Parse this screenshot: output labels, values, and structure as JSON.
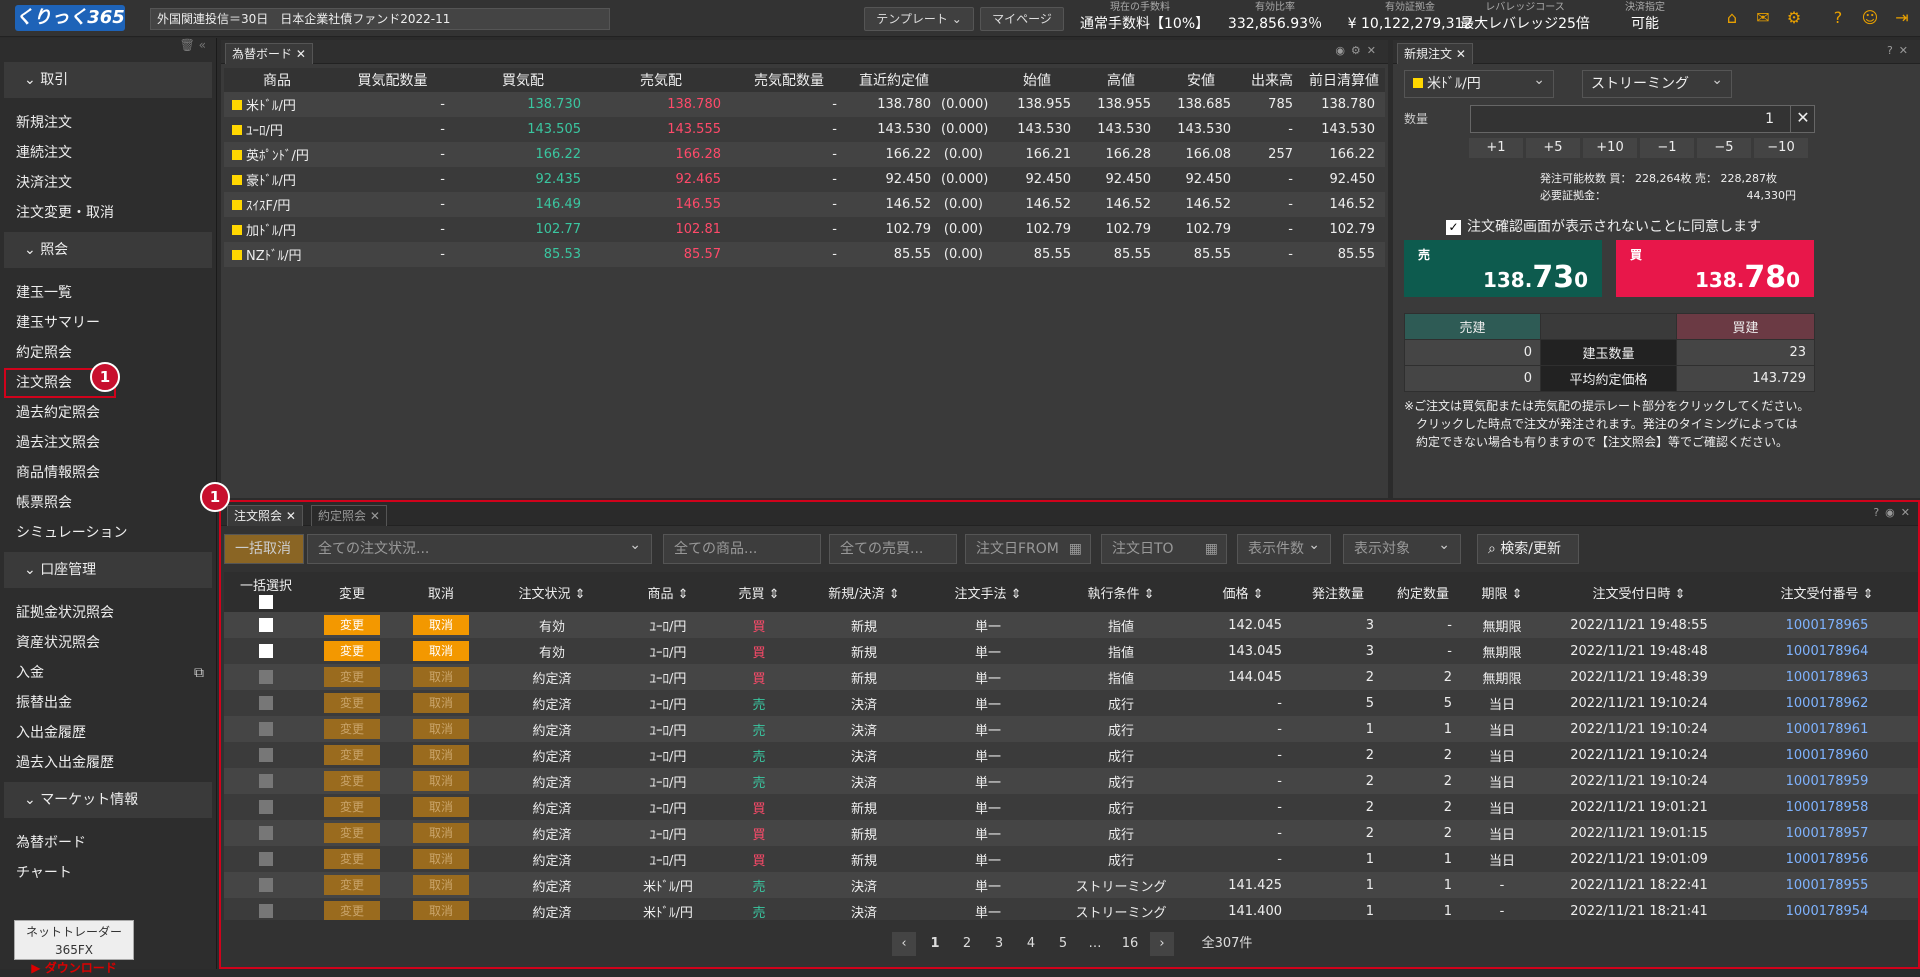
{
  "header": {
    "logo": "くりっく365",
    "ticker": "外国関連投信＝30日　日本企業社債ファンド2022-11",
    "template_btn": "テンプレート ⌄",
    "mypage_btn": "マイページ",
    "metrics": [
      {
        "k": "現在の手数料",
        "v": "通常手数料【10%】"
      },
      {
        "k": "有効比率",
        "v": "332,856.93％"
      },
      {
        "k": "有効証拠金",
        "v": "¥ 10,122,279,312"
      },
      {
        "k": "レバレッジコース",
        "v": "最大レバレッジ25倍"
      },
      {
        "k": "決済指定",
        "v": "可能"
      }
    ]
  },
  "sidebar": {
    "sections": [
      {
        "title": "取引",
        "items": [
          "新規注文",
          "連続注文",
          "決済注文",
          "注文変更・取消"
        ]
      },
      {
        "title": "照会",
        "items": [
          "建玉一覧",
          "建玉サマリー",
          "約定照会",
          "注文照会",
          "過去約定照会",
          "過去注文照会",
          "商品情報照会",
          "帳票照会",
          "シミュレーション"
        ]
      },
      {
        "title": "口座管理",
        "items": [
          "証拠金状況照会",
          "資産状況照会",
          "入金",
          "振替出金",
          "入出金履歴",
          "過去入出金履歴"
        ]
      },
      {
        "title": "マーケット情報",
        "items": [
          "為替ボード",
          "チャート"
        ]
      }
    ],
    "download_top": "ネットトレーダー365FX",
    "download_btn": "ダウンロード"
  },
  "badges": [
    "1",
    "1"
  ],
  "rate_board": {
    "tab": "為替ボード",
    "headers": [
      "商品",
      "買気配数量",
      "買気配",
      "売気配",
      "売気配数量",
      "直近約定値",
      "",
      "始値",
      "高値",
      "安値",
      "出来高",
      "前日清算値"
    ],
    "rows": [
      [
        "米ﾄﾞﾙ/円",
        "-",
        "138.730",
        "138.780",
        "-",
        "138.780",
        "(0.000)",
        "138.955",
        "138.955",
        "138.685",
        "785",
        "138.780"
      ],
      [
        "ﾕｰﾛ/円",
        "-",
        "143.505",
        "143.555",
        "-",
        "143.530",
        "(0.000)",
        "143.530",
        "143.530",
        "143.530",
        "-",
        "143.530"
      ],
      [
        "英ﾎﾟﾝﾄﾞ/円",
        "-",
        "166.22",
        "166.28",
        "-",
        "166.22",
        "(0.00)",
        "166.21",
        "166.28",
        "166.08",
        "257",
        "166.22"
      ],
      [
        "豪ﾄﾞﾙ/円",
        "-",
        "92.435",
        "92.465",
        "-",
        "92.450",
        "(0.000)",
        "92.450",
        "92.450",
        "92.450",
        "-",
        "92.450"
      ],
      [
        "ｽｲｽF/円",
        "-",
        "146.49",
        "146.55",
        "-",
        "146.52",
        "(0.00)",
        "146.52",
        "146.52",
        "146.52",
        "-",
        "146.52"
      ],
      [
        "加ﾄﾞﾙ/円",
        "-",
        "102.77",
        "102.81",
        "-",
        "102.79",
        "(0.00)",
        "102.79",
        "102.79",
        "102.79",
        "-",
        "102.79"
      ],
      [
        "NZﾄﾞﾙ/円",
        "-",
        "85.53",
        "85.57",
        "-",
        "85.55",
        "(0.00)",
        "85.55",
        "85.55",
        "85.55",
        "-",
        "85.55"
      ]
    ]
  },
  "new_order": {
    "tab": "新規注文",
    "pair": "米ﾄﾞﾙ/円",
    "mode": "ストリーミング",
    "qty_label": "数量",
    "qty": "1",
    "steps": [
      "+1",
      "+5",
      "+10",
      "−1",
      "−5",
      "−10"
    ],
    "avail": "発注可能枚数  買：  228,264枚  売：  228,287枚",
    "margin_label": "必要証拠金：",
    "margin": "44,330円",
    "confirm": "注文確認画面が表示されないことに同意します",
    "sell_label": "売",
    "sell_pre": "138.",
    "sell_big": "73",
    "sell_post": "0",
    "buy_label": "買",
    "buy_pre": "138.",
    "buy_big": "78",
    "buy_post": "0",
    "pos_sell": "売建",
    "pos_buy": "買建",
    "pos_qty_label": "建玉数量",
    "pos_qty_sell": "0",
    "pos_qty_buy": "23",
    "pos_avg_label": "平均約定価格",
    "pos_avg_sell": "0",
    "pos_avg_buy": "143.729",
    "note": [
      "※ご注文は買気配または売気配の提示レート部分をクリックしてください。",
      "　クリックした時点で注文が発注されます。発注のタイミングによっては",
      "　約定できない場合も有りますので【注文照会】等でご確認ください。"
    ]
  },
  "orders": {
    "tabs": [
      "注文照会",
      "約定照会"
    ],
    "filters": {
      "bulk_cancel": "一括取消",
      "status": "全ての注文状況...",
      "product": "全ての商品...",
      "side": "全ての売買...",
      "date_from": "注文日FROM",
      "date_to": "注文日TO",
      "count": "表示件数",
      "target": "表示対象",
      "search": "検索/更新"
    },
    "headers": [
      "一括選択",
      "変更",
      "取消",
      "注文状況 ⇕",
      "商品 ⇕",
      "売買 ⇕",
      "新規/決済 ⇕",
      "注文手法 ⇕",
      "執行条件 ⇕",
      "価格 ⇕",
      "発注数量",
      "約定数量",
      "期限 ⇕",
      "注文受付日時 ⇕",
      "注文受付番号 ⇕"
    ],
    "change_label": "変更",
    "cancel_label": "取消",
    "rows": [
      {
        "active": true,
        "status": "有効",
        "product": "ﾕｰﾛ/円",
        "side": "買",
        "type": "新規",
        "method": "単一",
        "cond": "指値",
        "price": "142.045",
        "qty": "3",
        "filled": "-",
        "limit": "無期限",
        "time": "2022/11/21 19:48:55",
        "no": "1000178965"
      },
      {
        "active": true,
        "status": "有効",
        "product": "ﾕｰﾛ/円",
        "side": "買",
        "type": "新規",
        "method": "単一",
        "cond": "指値",
        "price": "143.045",
        "qty": "3",
        "filled": "-",
        "limit": "無期限",
        "time": "2022/11/21 19:48:48",
        "no": "1000178964"
      },
      {
        "active": false,
        "status": "約定済",
        "product": "ﾕｰﾛ/円",
        "side": "買",
        "type": "新規",
        "method": "単一",
        "cond": "指値",
        "price": "144.045",
        "qty": "2",
        "filled": "2",
        "limit": "無期限",
        "time": "2022/11/21 19:48:39",
        "no": "1000178963"
      },
      {
        "active": false,
        "status": "約定済",
        "product": "ﾕｰﾛ/円",
        "side": "売",
        "type": "決済",
        "method": "単一",
        "cond": "成行",
        "price": "-",
        "qty": "5",
        "filled": "5",
        "limit": "当日",
        "time": "2022/11/21 19:10:24",
        "no": "1000178962"
      },
      {
        "active": false,
        "status": "約定済",
        "product": "ﾕｰﾛ/円",
        "side": "売",
        "type": "決済",
        "method": "単一",
        "cond": "成行",
        "price": "-",
        "qty": "1",
        "filled": "1",
        "limit": "当日",
        "time": "2022/11/21 19:10:24",
        "no": "1000178961"
      },
      {
        "active": false,
        "status": "約定済",
        "product": "ﾕｰﾛ/円",
        "side": "売",
        "type": "決済",
        "method": "単一",
        "cond": "成行",
        "price": "-",
        "qty": "2",
        "filled": "2",
        "limit": "当日",
        "time": "2022/11/21 19:10:24",
        "no": "1000178960"
      },
      {
        "active": false,
        "status": "約定済",
        "product": "ﾕｰﾛ/円",
        "side": "売",
        "type": "決済",
        "method": "単一",
        "cond": "成行",
        "price": "-",
        "qty": "2",
        "filled": "2",
        "limit": "当日",
        "time": "2022/11/21 19:10:24",
        "no": "1000178959"
      },
      {
        "active": false,
        "status": "約定済",
        "product": "ﾕｰﾛ/円",
        "side": "買",
        "type": "新規",
        "method": "単一",
        "cond": "成行",
        "price": "-",
        "qty": "2",
        "filled": "2",
        "limit": "当日",
        "time": "2022/11/21 19:01:21",
        "no": "1000178958"
      },
      {
        "active": false,
        "status": "約定済",
        "product": "ﾕｰﾛ/円",
        "side": "買",
        "type": "新規",
        "method": "単一",
        "cond": "成行",
        "price": "-",
        "qty": "2",
        "filled": "2",
        "limit": "当日",
        "time": "2022/11/21 19:01:15",
        "no": "1000178957"
      },
      {
        "active": false,
        "status": "約定済",
        "product": "ﾕｰﾛ/円",
        "side": "買",
        "type": "新規",
        "method": "単一",
        "cond": "成行",
        "price": "-",
        "qty": "1",
        "filled": "1",
        "limit": "当日",
        "time": "2022/11/21 19:01:09",
        "no": "1000178956"
      },
      {
        "active": false,
        "status": "約定済",
        "product": "米ﾄﾞﾙ/円",
        "side": "売",
        "type": "決済",
        "method": "単一",
        "cond": "ストリーミング",
        "price": "141.425",
        "qty": "1",
        "filled": "1",
        "limit": "-",
        "time": "2022/11/21 18:22:41",
        "no": "1000178955"
      },
      {
        "active": false,
        "status": "約定済",
        "product": "米ﾄﾞﾙ/円",
        "side": "売",
        "type": "決済",
        "method": "単一",
        "cond": "ストリーミング",
        "price": "141.400",
        "qty": "1",
        "filled": "1",
        "limit": "-",
        "time": "2022/11/21 18:21:41",
        "no": "1000178954"
      }
    ],
    "pages": [
      "1",
      "2",
      "3",
      "4",
      "5",
      "…",
      "16"
    ],
    "total": "全307件"
  },
  "colors": {
    "bid": "#3ac6a0",
    "ask": "#ff4a6a",
    "accent": "#f39800",
    "highlight": "#d0021b"
  }
}
